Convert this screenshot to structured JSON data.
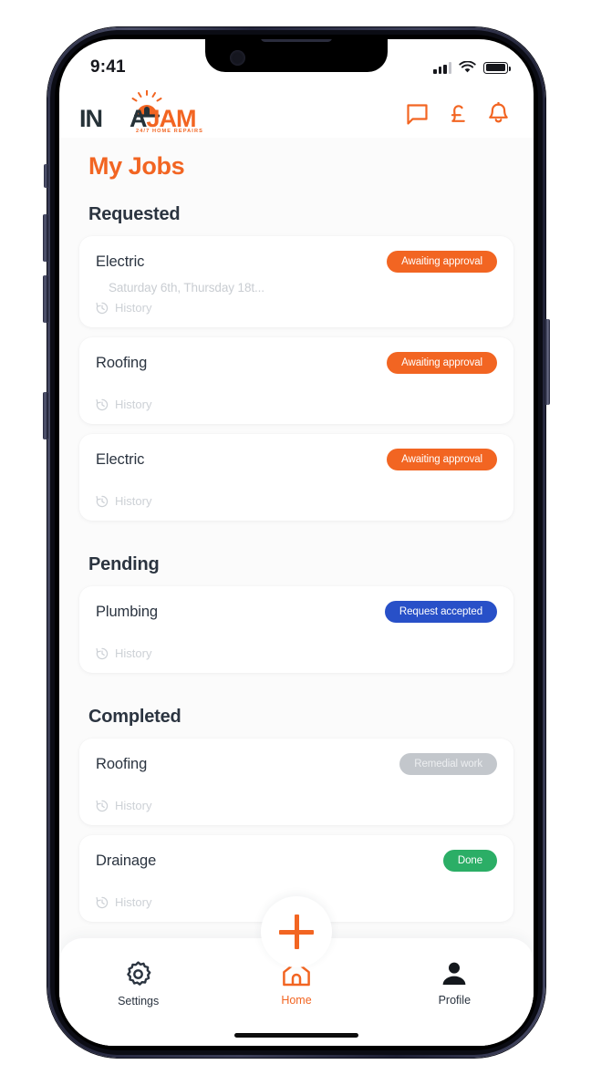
{
  "status_bar": {
    "time": "9:41",
    "signal_icon": "cellular-signal-icon",
    "wifi_icon": "wifi-icon",
    "battery_icon": "battery-full-icon"
  },
  "header": {
    "logo": {
      "part_in": "IN",
      "part_a": "A",
      "part_jam": "JAM",
      "tagline": "24/7 HOME REPAIRS",
      "beacon_icon": "siren-beacon-icon"
    },
    "icons": [
      {
        "name": "chat-icon",
        "label": "Messages"
      },
      {
        "name": "pound-icon",
        "label": "Payments"
      },
      {
        "name": "bell-icon",
        "label": "Notifications"
      }
    ]
  },
  "page": {
    "title": "My Jobs"
  },
  "sections": [
    {
      "title": "Requested",
      "jobs": [
        {
          "title": "Electric",
          "badge": "Awaiting approval",
          "badge_style": "orange",
          "date": "Saturday 6th, Thursday 18t...",
          "history_label": "History",
          "history_icon": "clock-history-icon"
        },
        {
          "title": "Roofing",
          "badge": "Awaiting approval",
          "badge_style": "orange",
          "date": "",
          "history_label": "History",
          "history_icon": "clock-history-icon"
        },
        {
          "title": "Electric",
          "badge": "Awaiting approval",
          "badge_style": "orange",
          "date": "",
          "history_label": "History",
          "history_icon": "clock-history-icon"
        }
      ]
    },
    {
      "title": "Pending",
      "jobs": [
        {
          "title": "Plumbing",
          "badge": "Request accepted",
          "badge_style": "blue",
          "date": "",
          "history_label": "History",
          "history_icon": "clock-history-icon"
        }
      ]
    },
    {
      "title": "Completed",
      "jobs": [
        {
          "title": "Roofing",
          "badge": "Remedial work",
          "badge_style": "grey",
          "date": "",
          "history_label": "History",
          "history_icon": "clock-history-icon"
        },
        {
          "title": "Drainage",
          "badge": "Done",
          "badge_style": "green",
          "date": "",
          "history_label": "History",
          "history_icon": "clock-history-icon"
        }
      ]
    }
  ],
  "fab": {
    "icon": "plus-icon",
    "label": "Add job"
  },
  "bottom_nav": {
    "items": [
      {
        "label": "Settings",
        "icon": "gear-icon",
        "active": false
      },
      {
        "label": "Home",
        "icon": "home-icon",
        "active": true
      },
      {
        "label": "Profile",
        "icon": "person-icon",
        "active": false
      }
    ]
  },
  "colors": {
    "accent_orange": "#F26522",
    "badge_blue": "#2850C8",
    "badge_grey": "#C3C7CC",
    "badge_green": "#2BAE66",
    "text_dark": "#2B3440",
    "muted": "#CDD1D6"
  }
}
